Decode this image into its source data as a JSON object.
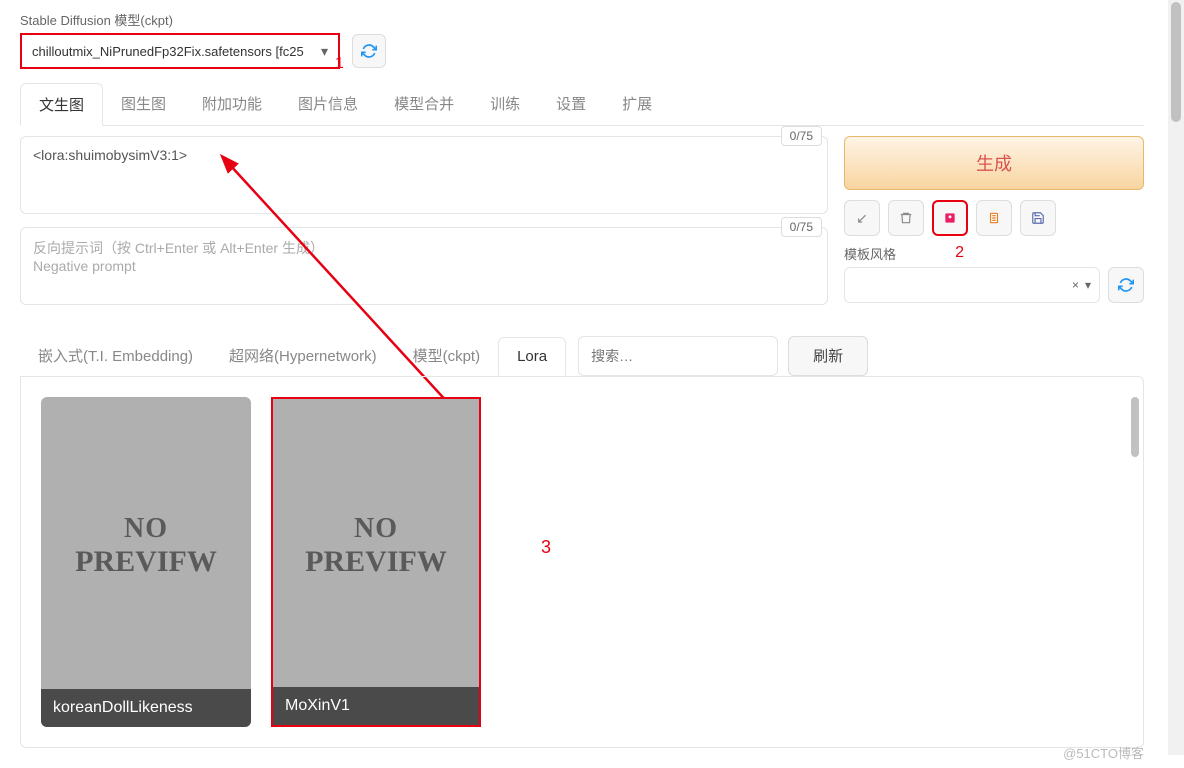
{
  "top_label": "Stable Diffusion 模型(ckpt)",
  "dropdown_value": "chilloutmix_NiPrunedFp32Fix.safetensors [fc25",
  "main_tabs": [
    "文生图",
    "图生图",
    "附加功能",
    "图片信息",
    "模型合并",
    "训练",
    "设置",
    "扩展"
  ],
  "main_tab_active": 0,
  "prompt_value": "<lora:shuimobysimV3:1>",
  "prompt_counter": "0/75",
  "neg_placeholder_1": "反向提示词（按 Ctrl+Enter 或 Alt+Enter 生成）",
  "neg_placeholder_2": "Negative prompt",
  "neg_counter": "0/75",
  "generate_label": "生成",
  "style_label": "模板风格",
  "style_clear": "×",
  "extra_tabs": [
    "嵌入式(T.I. Embedding)",
    "超网络(Hypernetwork)",
    "模型(ckpt)",
    "Lora"
  ],
  "extra_tab_active": 3,
  "search_placeholder": "搜索…",
  "refresh_label": "刷新",
  "cards": [
    {
      "name": "koreanDollLikeness",
      "selected": false
    },
    {
      "name": "MoXinV1",
      "selected": true
    }
  ],
  "no_preview_1": "NO",
  "no_preview_2": "PREVIFW",
  "annotations": {
    "a1": "1",
    "a2": "2",
    "a3": "3"
  },
  "watermark": "@51CTO博客"
}
